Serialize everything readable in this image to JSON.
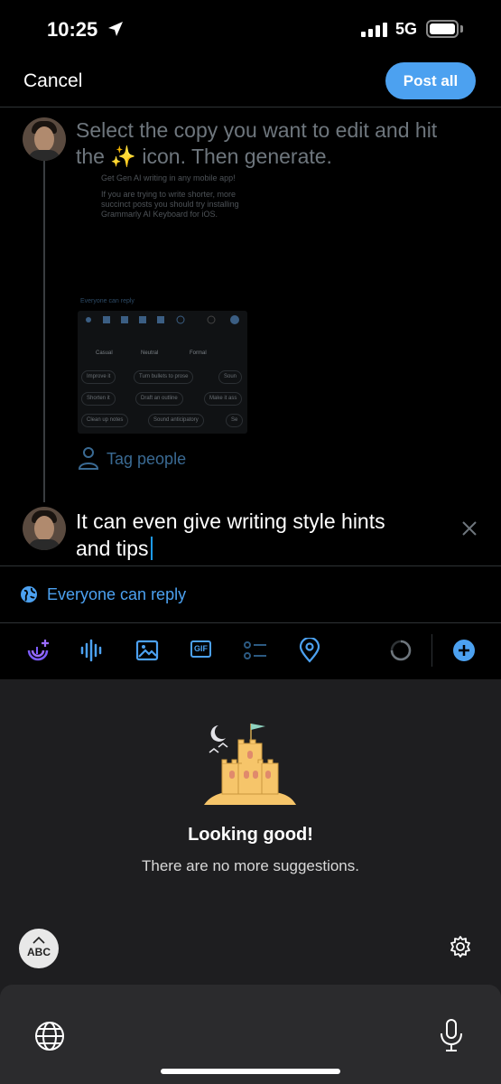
{
  "status_bar": {
    "time": "10:25",
    "network": "5G"
  },
  "header": {
    "cancel_label": "Cancel",
    "post_all_label": "Post all"
  },
  "thread": {
    "first_post_placeholder": "Select the copy you want to edit and hit the ✨ icon. Then generate.",
    "embedded_screenshot": {
      "line1": "Get Gen AI writing in any mobile app!",
      "line2": "If you are trying to write shorter, more succinct posts you should try installing Grammarly AI Keyboard for iOS.",
      "reply_setting": "Everyone can reply",
      "tabs": [
        "Casual",
        "Neutral",
        "Formal"
      ],
      "chips": [
        "Improve it",
        "Turn bullets to prose",
        "Soun",
        "Shorten it",
        "Draft an outline",
        "Make it ass",
        "Clean up notes",
        "Sound anticipatory",
        "Se"
      ]
    },
    "tag_people_label": "Tag people",
    "second_post_text": "It can even give writing style hints and tips"
  },
  "reply_setting": {
    "label": "Everyone can reply"
  },
  "toolbar": {
    "gif_label": "GIF"
  },
  "keyboard": {
    "title": "Looking good!",
    "subtitle": "There are no more suggestions.",
    "abc_label": "ABC"
  },
  "colors": {
    "accent": "#4ca1f0",
    "background": "#000000",
    "keyboard_bg": "#1e1e20"
  }
}
